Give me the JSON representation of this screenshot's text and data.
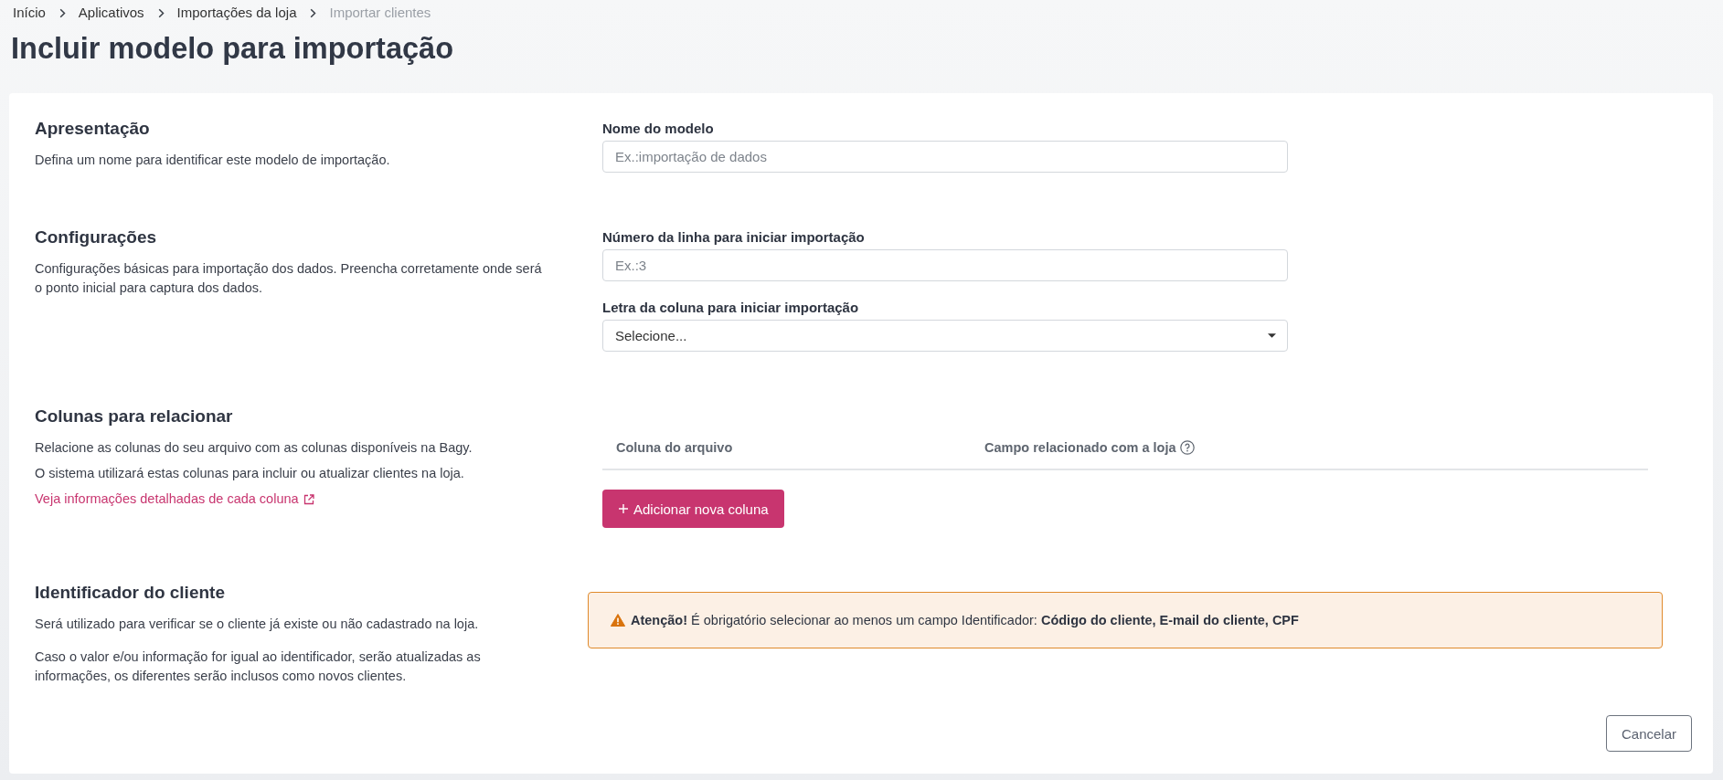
{
  "breadcrumb": [
    {
      "label": "Início",
      "current": false
    },
    {
      "label": "Aplicativos",
      "current": false
    },
    {
      "label": "Importações da loja",
      "current": false
    },
    {
      "label": "Importar clientes",
      "current": true
    }
  ],
  "page_title": "Incluir modelo para importação",
  "sections": [
    {
      "kind": "fields",
      "title": "Apresentação",
      "description": [
        "Defina um nome para identificar este modelo de importação."
      ],
      "fields": [
        {
          "kind": "text",
          "label": "Nome do modelo",
          "placeholder": "Ex.:importação de dados"
        }
      ]
    },
    {
      "kind": "fields",
      "title": "Configurações",
      "description": [
        "Configurações básicas para importação dos dados. Preencha corretamente onde será o ponto inicial para captura dos dados."
      ],
      "fields": [
        {
          "kind": "text",
          "label": "Número da linha para iniciar importação",
          "placeholder": "Ex.:3"
        },
        {
          "kind": "select",
          "label": "Letra da coluna para iniciar importação",
          "value": "Selecione..."
        }
      ]
    },
    {
      "kind": "mapping",
      "title": "Colunas para relacionar",
      "description": [
        "Relacione as colunas do seu arquivo com as colunas disponíveis na Bagy.",
        "O sistema utilizará estas colunas para incluir ou atualizar clientes na loja."
      ],
      "link": "Veja informações detalhadas de cada coluna",
      "columns": [
        {
          "label": "Coluna do arquivo",
          "help": false
        },
        {
          "label": "Campo relacionado com a loja",
          "help": true
        }
      ],
      "add_button": "Adicionar nova coluna"
    },
    {
      "kind": "notice",
      "title": "Identificador do cliente",
      "description": [
        "Será utilizado para verificar se o cliente já existe ou não cadastrado na loja.",
        "Caso o valor e/ou informação for igual ao identificador, serão atualizadas as informações, os diferentes serão inclusos como novos clientes."
      ],
      "alert": {
        "kind": "warning",
        "text": "**Atenção!** É obrigatório selecionar ao menos um campo Identificador: **Código do cliente, E-mail do cliente, CPF**"
      }
    }
  ],
  "actions": [
    {
      "kind": "secondary",
      "label": "Cancelar"
    }
  ]
}
